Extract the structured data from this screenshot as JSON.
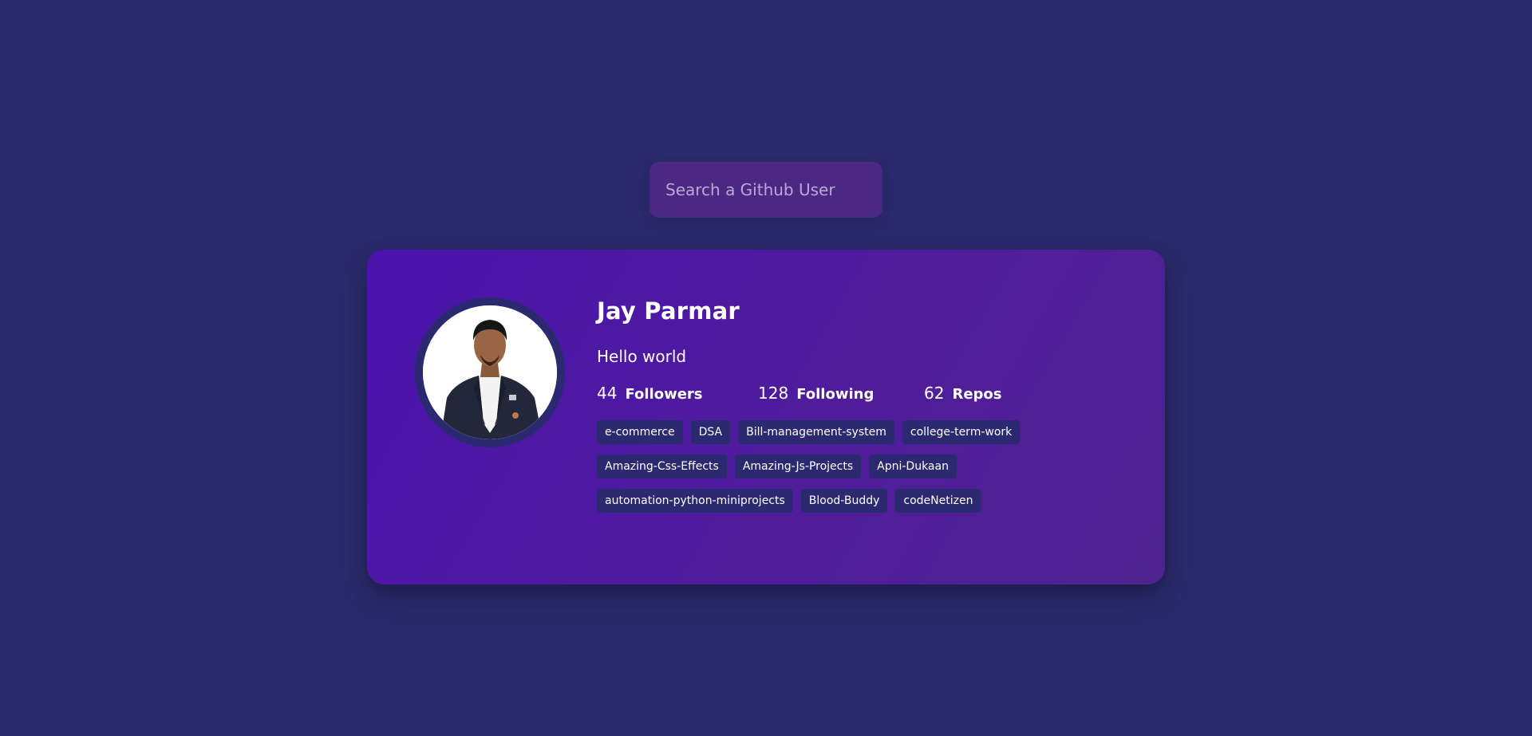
{
  "search": {
    "placeholder": "Search a Github User",
    "value": ""
  },
  "profile": {
    "name": "Jay Parmar",
    "bio": "Hello world",
    "avatar_alt": "Jay Parmar"
  },
  "stats": [
    {
      "value": "44",
      "label": "Followers"
    },
    {
      "value": "128",
      "label": "Following"
    },
    {
      "value": "62",
      "label": "Repos"
    }
  ],
  "repos": [
    "e-commerce",
    "DSA",
    "Bill-management-system",
    "college-term-work",
    "Amazing-Css-Effects",
    "Amazing-Js-Projects",
    "Apni-Dukaan",
    "automation-python-miniprojects",
    "Blood-Buddy",
    "codeNetizen"
  ],
  "colors": {
    "page_background": "#2a2a6c",
    "search_background": "#4c2885",
    "card_gradient_start": "#4b13ad",
    "card_gradient_end": "#4f2290",
    "repo_background": "#2b2a70",
    "avatar_ring": "#2b2a70"
  }
}
